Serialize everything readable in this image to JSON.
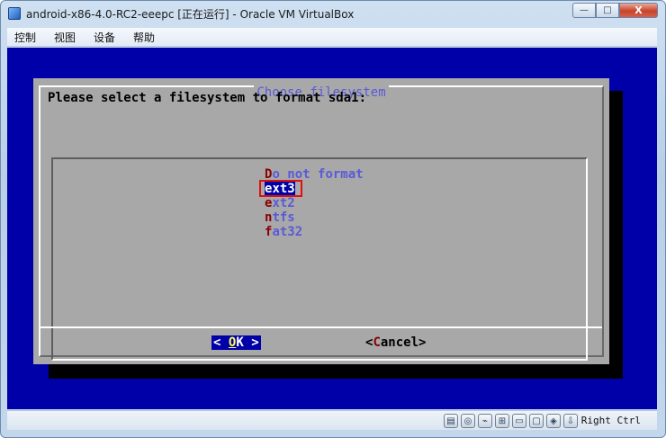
{
  "window": {
    "title": "android-x86-4.0-RC2-eeepc [正在运行] - Oracle VM VirtualBox",
    "minimize_icon": "minimize-icon",
    "maximize_icon": "maximize-icon",
    "close_icon": "close-icon",
    "minimize_glyph": "—",
    "maximize_glyph": "□",
    "close_glyph": "X"
  },
  "menu": {
    "items": [
      "控制",
      "视图",
      "设备",
      "帮助"
    ]
  },
  "dialog": {
    "title": "Choose filesystem",
    "prompt": "Please select a filesystem to format sda1:",
    "options": [
      {
        "hot": "D",
        "rest": "o not format"
      },
      {
        "hot": "e",
        "rest": "xt3"
      },
      {
        "hot": "e",
        "rest": "xt2"
      },
      {
        "hot": "n",
        "rest": "tfs"
      },
      {
        "hot": "f",
        "rest": "at32"
      }
    ],
    "selected_option": "ext3",
    "ok_button": {
      "left": "<",
      "hot": "O",
      "rest": "K",
      "right": ">"
    },
    "cancel_button": {
      "left": "<",
      "hot": "C",
      "rest": "ancel",
      "right": ">"
    }
  },
  "statusbar": {
    "icons": [
      "hard-disk-icon",
      "optical-disk-icon",
      "usb-icon",
      "network-icon",
      "shared-folders-icon",
      "display-icon",
      "mouse-integration-icon",
      "keyboard-capture-icon"
    ],
    "host_key": "Right Ctrl"
  },
  "colors": {
    "screen_bg": "#0000a8",
    "dialog_bg": "#a8a8a8",
    "option_text": "#5a5ad8",
    "hotkey": "#8a0000",
    "selection_marker": "#e01010"
  }
}
